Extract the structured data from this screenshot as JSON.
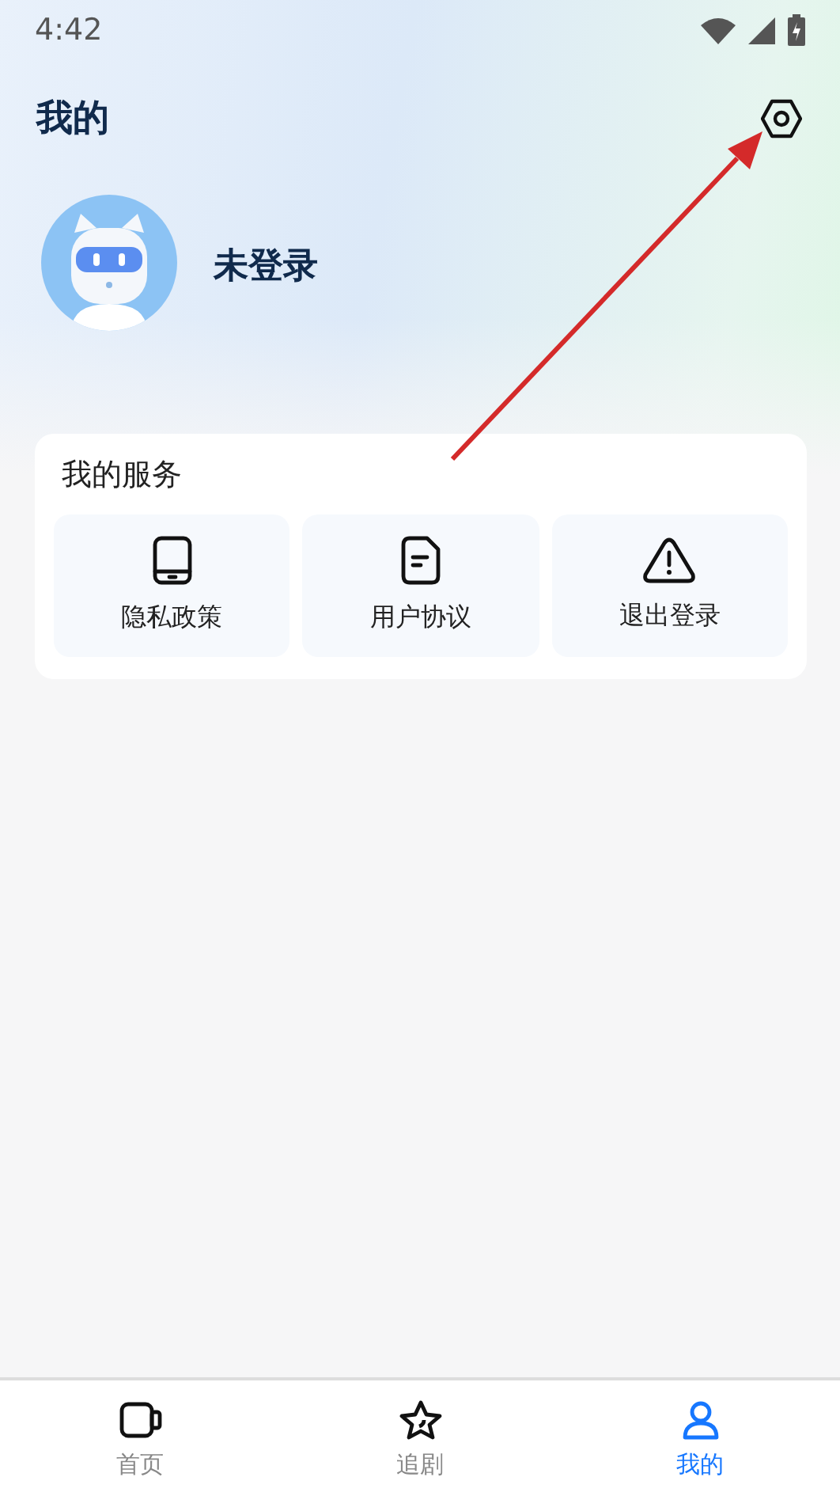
{
  "status_bar": {
    "time": "4:42"
  },
  "header": {
    "title": "我的"
  },
  "profile": {
    "name": "未登录"
  },
  "services": {
    "title": "我的服务",
    "items": [
      {
        "kind": "phone",
        "label": "隐私政策"
      },
      {
        "kind": "document",
        "label": "用户协议"
      },
      {
        "kind": "warning",
        "label": "退出登录"
      }
    ]
  },
  "tab_bar": [
    {
      "kind": "video",
      "label": "首页",
      "selected": false
    },
    {
      "kind": "star",
      "label": "追剧",
      "selected": false
    },
    {
      "kind": "person",
      "label": "我的",
      "selected": true
    }
  ]
}
